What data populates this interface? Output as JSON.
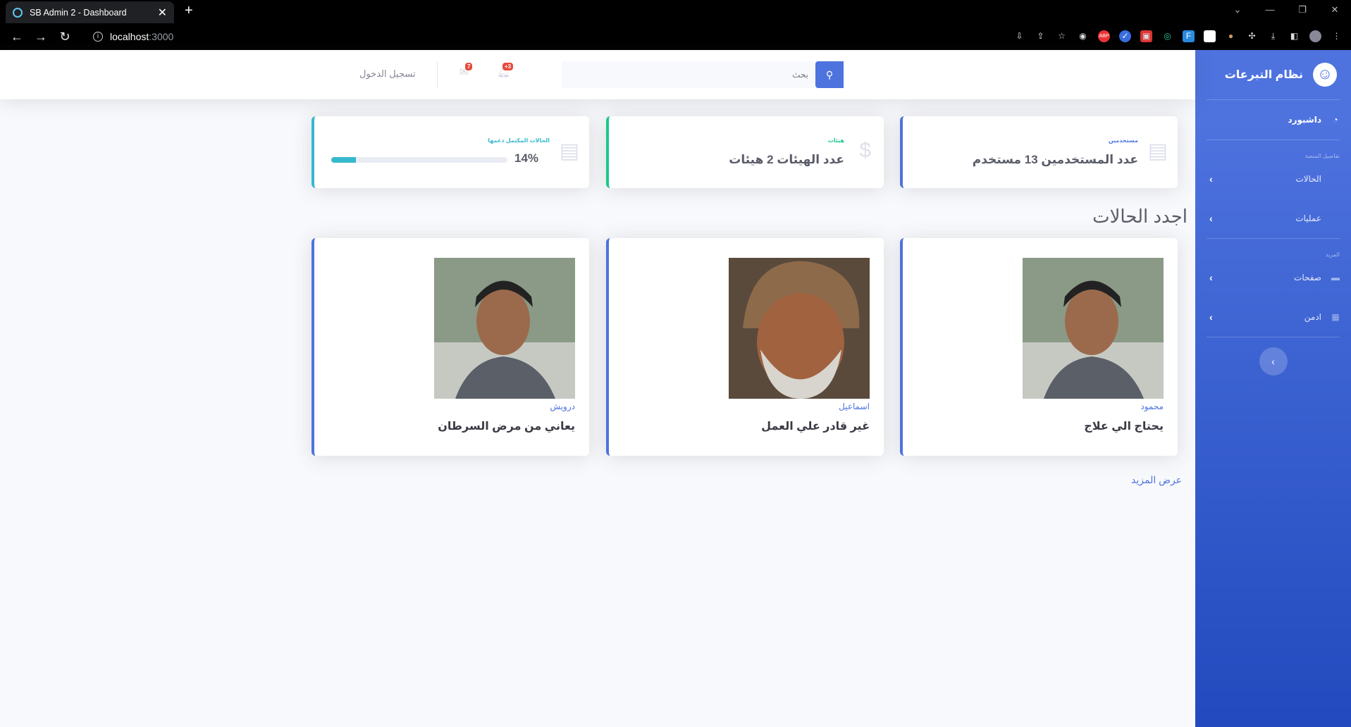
{
  "browser": {
    "tab_title": "SB Admin 2 - Dashboard",
    "url_host": "localhost",
    "url_port": ":3000"
  },
  "sidebar": {
    "brand": "نظام التبرعات",
    "dashboard": "داشبورد",
    "heading_platform": "تفاصيل المنصة",
    "cases": "الحالات",
    "operations": "عمليات",
    "heading_more": "المزيد",
    "pages": "صفحات",
    "admin": "ادمن"
  },
  "topbar": {
    "search_placeholder": "بحث",
    "alerts_badge": "+3",
    "messages_badge": "7",
    "login": "تسجيل الدخول"
  },
  "stats": [
    {
      "label": "مستخدمين",
      "value": "عدد المستخدمين 13 مستخدم",
      "color": "#4e73df"
    },
    {
      "label": "هيئات",
      "value": "عدد الهيئات 2 هيئات",
      "color": "#1cc88a"
    },
    {
      "label": "الحالات المكتمل دعمها",
      "value": "14%",
      "progress": 0.14,
      "color": "#36b9cc"
    }
  ],
  "section_title": "اجدد الحالات",
  "cases": [
    {
      "name": "محمود",
      "need": "يحتاج الي علاج"
    },
    {
      "name": "اسماعيل",
      "need": "غير قادر علي العمل"
    },
    {
      "name": "درويش",
      "need": "يعاني من مرض السرطان"
    }
  ],
  "more_link": "عرض المزيد"
}
